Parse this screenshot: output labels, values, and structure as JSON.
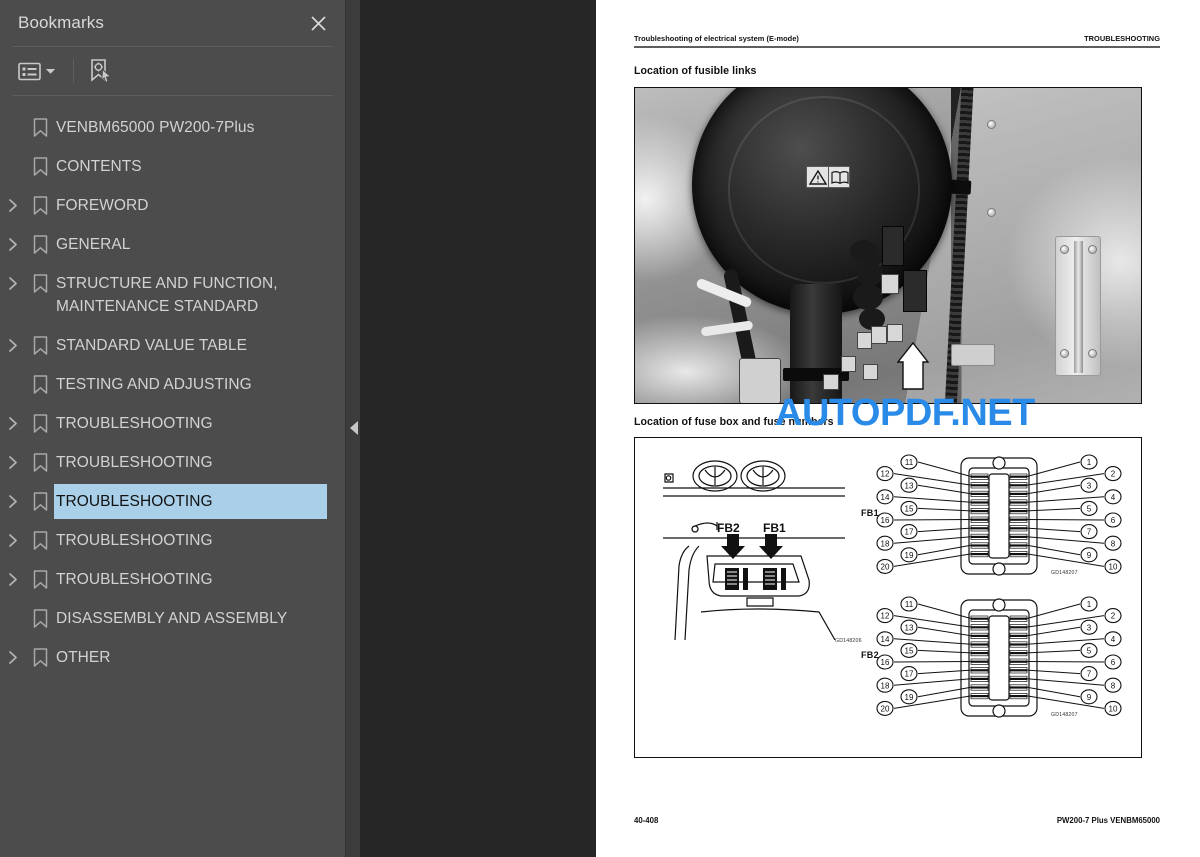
{
  "sidebar": {
    "title": "Bookmarks",
    "close_icon": "close-icon",
    "toolbar": {
      "list_options_label": "list-options-icon",
      "list_options_caret": "chevron-down-icon",
      "new_bookmark_label": "new-bookmark-icon"
    },
    "items": [
      {
        "label": "VENBM65000 PW200-7Plus",
        "expandable": false,
        "selected": false
      },
      {
        "label": "CONTENTS",
        "expandable": false,
        "selected": false
      },
      {
        "label": "FOREWORD",
        "expandable": true,
        "selected": false
      },
      {
        "label": "GENERAL",
        "expandable": true,
        "selected": false
      },
      {
        "label": "STRUCTURE AND FUNCTION,\nMAINTENANCE STANDARD",
        "expandable": true,
        "selected": false
      },
      {
        "label": "STANDARD VALUE TABLE",
        "expandable": true,
        "selected": false
      },
      {
        "label": "TESTING AND ADJUSTING",
        "expandable": false,
        "selected": false
      },
      {
        "label": "TROUBLESHOOTING",
        "expandable": true,
        "selected": false
      },
      {
        "label": "TROUBLESHOOTING",
        "expandable": true,
        "selected": false
      },
      {
        "label": "TROUBLESHOOTING",
        "expandable": true,
        "selected": true
      },
      {
        "label": "TROUBLESHOOTING",
        "expandable": true,
        "selected": false
      },
      {
        "label": "TROUBLESHOOTING",
        "expandable": true,
        "selected": false
      },
      {
        "label": "DISASSEMBLY AND ASSEMBLY",
        "expandable": false,
        "selected": false
      },
      {
        "label": "OTHER",
        "expandable": true,
        "selected": false
      }
    ],
    "colors": {
      "background": "#4c4c4c",
      "selection": "#a9cfe9",
      "text": "#d2d2d2"
    }
  },
  "divider": {
    "collapse_icon": "triangle-left-icon"
  },
  "watermark": {
    "text": "AUTOPDF.NET",
    "color": "#2a8ae8"
  },
  "page": {
    "header_left": "Troubleshooting of electrical system (E-mode)",
    "header_right": "TROUBLESHOOTING",
    "section1_title": "Location of fusible links",
    "section2_title": "Location of fuse box and fuse numbers",
    "footer_left": "40-408",
    "footer_right": "PW200-7 Plus  VENBM65000",
    "figure1": {
      "type": "photograph",
      "description": "grayscale photo of air cleaner and wiring harness with white callout arrow"
    },
    "figure2": {
      "cab_drawing_code": "GD148206",
      "cab_labels": [
        "FB2",
        "FB1"
      ],
      "fuse_boxes": [
        {
          "name": "FB1",
          "code": "GD148207",
          "right_numbers": [
            "1",
            "2",
            "3",
            "4",
            "5",
            "6",
            "7",
            "8",
            "9",
            "10"
          ],
          "left_numbers": [
            "11",
            "12",
            "13",
            "14",
            "15",
            "16",
            "17",
            "18",
            "19",
            "20"
          ]
        },
        {
          "name": "FB2",
          "code": "GD148207",
          "right_numbers": [
            "1",
            "2",
            "3",
            "4",
            "5",
            "6",
            "7",
            "8",
            "9",
            "10"
          ],
          "left_numbers": [
            "11",
            "12",
            "13",
            "14",
            "15",
            "16",
            "17",
            "18",
            "19",
            "20"
          ]
        }
      ]
    }
  }
}
